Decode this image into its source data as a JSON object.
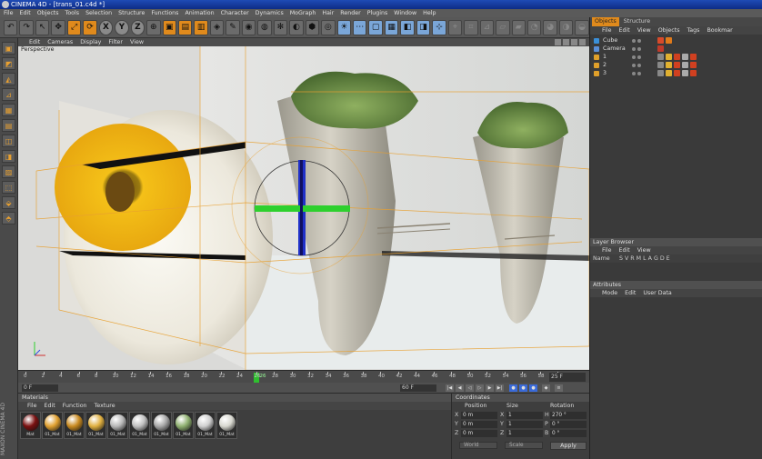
{
  "window": {
    "title": "CINEMA 4D - [trans_01.c4d *]"
  },
  "menu": [
    "File",
    "Edit",
    "Objects",
    "Tools",
    "Selection",
    "Structure",
    "Functions",
    "Animation",
    "Character",
    "Dynamics",
    "MoGraph",
    "Hair",
    "Render",
    "Plugins",
    "Window",
    "Help"
  ],
  "toolbar": {
    "icons": [
      "undo-icon",
      "redo-icon",
      "live-select-icon",
      "move-icon",
      "scale-icon",
      "rotate-icon",
      "x-axis-icon",
      "y-axis-icon",
      "z-axis-icon",
      "coordinate-system-icon",
      "render-view-icon",
      "render-picture-viewer-icon",
      "edit-render-settings-icon",
      "cube-icon",
      "spline-pen-icon",
      "nurbs-icon",
      "array-icon",
      "particle-icon",
      "deformer-icon",
      "scene-icon",
      "camera-icon",
      "light-icon",
      "points-mode-icon",
      "edges-mode-icon",
      "polygons-mode-icon",
      "model-mode-icon",
      "texture-mode-icon",
      "axis-mode-icon",
      "tweak-mode-icon",
      "snap-icon",
      "enable-axis-icon",
      "workplane-icon",
      "locked-workplane-icon",
      "render-active-icon",
      "render-region-icon",
      "interactive-render-icon",
      "save-icon"
    ],
    "axis_labels": [
      "X",
      "Y",
      "Z"
    ]
  },
  "viewport": {
    "menu": [
      "Edit",
      "Cameras",
      "Display",
      "Filter",
      "View"
    ],
    "label": "Perspective"
  },
  "timeline": {
    "ticks": [
      "0",
      "2",
      "4",
      "6",
      "8",
      "10",
      "12",
      "14",
      "16",
      "18",
      "20",
      "22",
      "24",
      "26",
      "28",
      "30",
      "32",
      "34",
      "36",
      "38",
      "40",
      "42",
      "44",
      "46",
      "48",
      "50",
      "52",
      "54",
      "56",
      "58",
      "60"
    ],
    "current_frame_label": "26",
    "current_frame": 26,
    "max_frame": 60,
    "fps": "25 F",
    "start_field": "0 F",
    "end_field": "60 F"
  },
  "materials": {
    "title": "Materials",
    "menu": [
      "File",
      "Edit",
      "Function",
      "Texture"
    ],
    "items": [
      {
        "name": "Mat",
        "color": "#7a1010"
      },
      {
        "name": "01_Mat",
        "color": "#e0a030"
      },
      {
        "name": "01_Mat",
        "color": "#c98a20"
      },
      {
        "name": "01_Mat",
        "color": "#e0b040"
      },
      {
        "name": "01_Mat",
        "color": "#b8b8b8"
      },
      {
        "name": "01_Mat",
        "color": "#c0c0c0"
      },
      {
        "name": "01_Mat",
        "color": "#a8a8a8"
      },
      {
        "name": "01_Mat",
        "color": "#8fb070"
      },
      {
        "name": "01_Mat",
        "color": "#d0d0d0"
      },
      {
        "name": "01_Mat",
        "color": "#d8d8d0"
      }
    ]
  },
  "logo": "MAXON CINEMA 4D",
  "coordinates": {
    "title": "Coordinates",
    "headers": [
      "Position",
      "Size",
      "Rotation"
    ],
    "rows": [
      {
        "axis": "X",
        "pos": "0 m",
        "size_axis": "X",
        "size": "1",
        "rot_axis": "H",
        "rot": "270 °"
      },
      {
        "axis": "Y",
        "pos": "0 m",
        "size_axis": "Y",
        "size": "1",
        "rot_axis": "P",
        "rot": "0 °"
      },
      {
        "axis": "Z",
        "pos": "0 m",
        "size_axis": "Z",
        "size": "1",
        "rot_axis": "B",
        "rot": "0 °"
      }
    ],
    "mode_select": "World",
    "size_select": "Scale",
    "apply_label": "Apply"
  },
  "object_manager": {
    "tabs": [
      "Objects",
      "Structure"
    ],
    "menu": [
      "File",
      "Edit",
      "View",
      "Objects",
      "Tags",
      "Bookmar"
    ],
    "objects": [
      {
        "name": "Cube",
        "icon_color": "#3a8fd8",
        "tags": [
          "#d84a2a",
          "#e07a1a"
        ]
      },
      {
        "name": "Camera",
        "icon_color": "#5a8fd8",
        "tags": [
          "#c03a2a"
        ]
      },
      {
        "name": "1",
        "icon_color": "#e0a02a",
        "tags": [
          "#888",
          "#e0b030",
          "#d04020",
          "#aaa",
          "#d04020"
        ]
      },
      {
        "name": "2",
        "icon_color": "#e0a02a",
        "tags": [
          "#888",
          "#e0b030",
          "#d04020",
          "#aaa",
          "#d04020"
        ]
      },
      {
        "name": "3",
        "icon_color": "#e0a02a",
        "tags": [
          "#888",
          "#e0b030",
          "#d04020",
          "#aaa",
          "#d04020"
        ]
      }
    ]
  },
  "layer_browser": {
    "title": "Layer Browser",
    "menu": [
      "File",
      "Edit",
      "View"
    ],
    "name_col": "Name",
    "flags": "S V R M L A G D E"
  },
  "attributes": {
    "title": "Attributes",
    "menu": [
      "Mode",
      "Edit",
      "User Data"
    ]
  }
}
